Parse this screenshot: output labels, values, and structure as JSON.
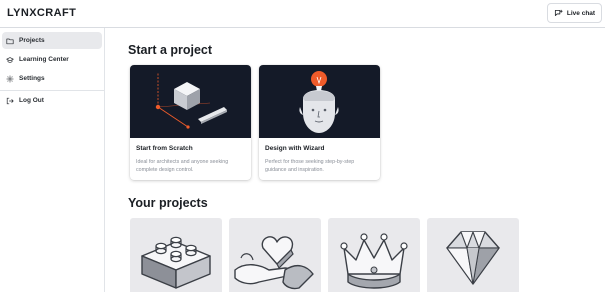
{
  "app": {
    "logo": "LYNXCRAFT"
  },
  "header": {
    "live_chat_label": "Live chat",
    "live_chat_icon": "chat-plus-icon"
  },
  "sidebar": {
    "items": [
      {
        "label": "Projects",
        "icon": "folder-icon",
        "active": true
      },
      {
        "label": "Learning Center",
        "icon": "graduation-cap-icon",
        "active": false
      },
      {
        "label": "Settings",
        "icon": "gear-icon",
        "active": false
      },
      {
        "label": "Log Out",
        "icon": "logout-icon",
        "active": false
      }
    ]
  },
  "main": {
    "start_title": "Start a project",
    "cards": [
      {
        "title": "Start from Scratch",
        "description": "Ideal for architects and anyone seeking complete design control.",
        "image": "cube-blueprint-image"
      },
      {
        "title": "Design with Wizard",
        "description": "Perfect for those seeking step-by-step guidance and inspiration.",
        "image": "head-lightbulb-image"
      }
    ],
    "projects_title": "Your projects",
    "projects": [
      {
        "image": "lego-brick-image"
      },
      {
        "image": "hands-heart-image"
      },
      {
        "image": "crown-image"
      },
      {
        "image": "diamond-image"
      }
    ]
  },
  "colors": {
    "accent": "#ef5b2a",
    "card_art_bg": "#141a28",
    "project_bg": "#e9e9ec",
    "active_nav_bg": "#e8e9ec"
  }
}
